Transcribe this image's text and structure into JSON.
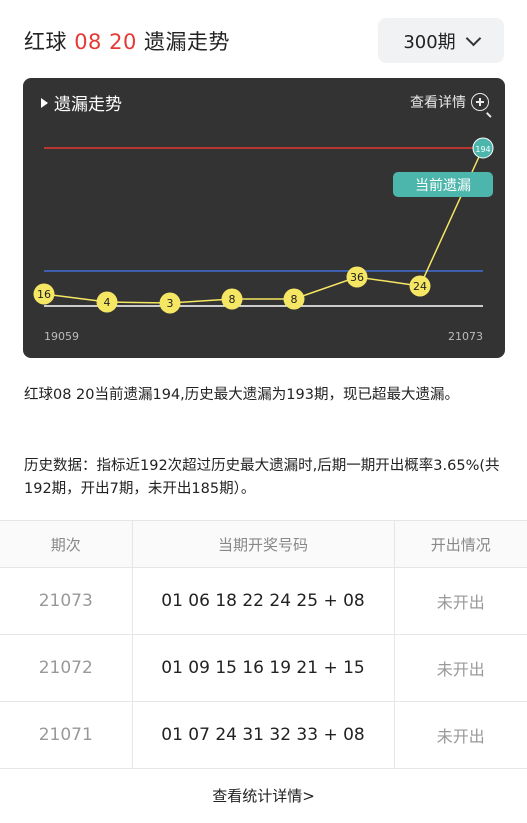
{
  "header": {
    "title_prefix": "红球",
    "title_numbers": "08 20",
    "title_suffix": "遗漏走势",
    "period_value": "300期"
  },
  "chart_card": {
    "title": "遗漏走势",
    "detail_label": "查看详情"
  },
  "chart_data": {
    "type": "line",
    "x_start_label": "19059",
    "x_end_label": "21073",
    "values": [
      16,
      4,
      3,
      8,
      8,
      36,
      24,
      194
    ],
    "point_labels": [
      "16",
      "4",
      "3",
      "8",
      "8",
      "36",
      "24",
      "194"
    ],
    "current_badge": "当前遗漏",
    "reference_lines": [
      "red",
      "blue",
      "white"
    ],
    "colors": {
      "background": "#333333",
      "line": "#f5e663",
      "point_fill": "#f5e663",
      "last_point_fill": "#4db6ac",
      "badge": "#4db6ac",
      "red_line": "#e53935",
      "blue_line": "#3f6fd8",
      "white_line": "#ffffff"
    }
  },
  "description": {
    "paragraph1": "红球08 20当前遗漏194,历史最大遗漏为193期，现已超最大遗漏。",
    "paragraph2": "历史数据：指标近192次超过历史最大遗漏时,后期一期开出概率3.65%(共192期，开出7期，未开出185期）。"
  },
  "table": {
    "headers": [
      "期次",
      "当期开奖号码",
      "开出情况"
    ],
    "rows": [
      {
        "issue": "21073",
        "numbers": "01 06 18 22 24 25 + 08",
        "status": "未开出"
      },
      {
        "issue": "21072",
        "numbers": "01 09 15 16 19 21 + 15",
        "status": "未开出"
      },
      {
        "issue": "21071",
        "numbers": "01 07 24 31 32 33 + 08",
        "status": "未开出"
      }
    ]
  },
  "footer": {
    "link_label": "查看统计详情>"
  }
}
